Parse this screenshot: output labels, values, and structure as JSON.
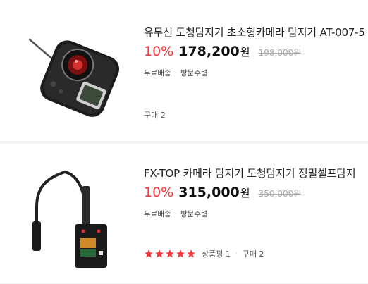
{
  "products": [
    {
      "image": "camera-detector-photo",
      "title": "유무선 도청탐지기 초소형카메라 탐지기 AT-007-5",
      "discount": "10%",
      "price": "178,200",
      "currency": "원",
      "original_price": "198,000원",
      "tags": [
        "무료배송",
        "방문수령"
      ],
      "purchases": "구매 2"
    },
    {
      "image": "fx-top-detector-photo",
      "title": "FX-TOP 카메라 탐지기 도청탐지기 정밀셀프탐지",
      "discount": "10%",
      "price": "315,000",
      "currency": "원",
      "original_price": "350,000원",
      "tags": [
        "무료배송",
        "방문수령"
      ],
      "rating": 5,
      "review": "상품평 1",
      "purchases": "구매 2"
    }
  ],
  "colors": {
    "accent": "#f4363a",
    "star": "#f4363a"
  }
}
